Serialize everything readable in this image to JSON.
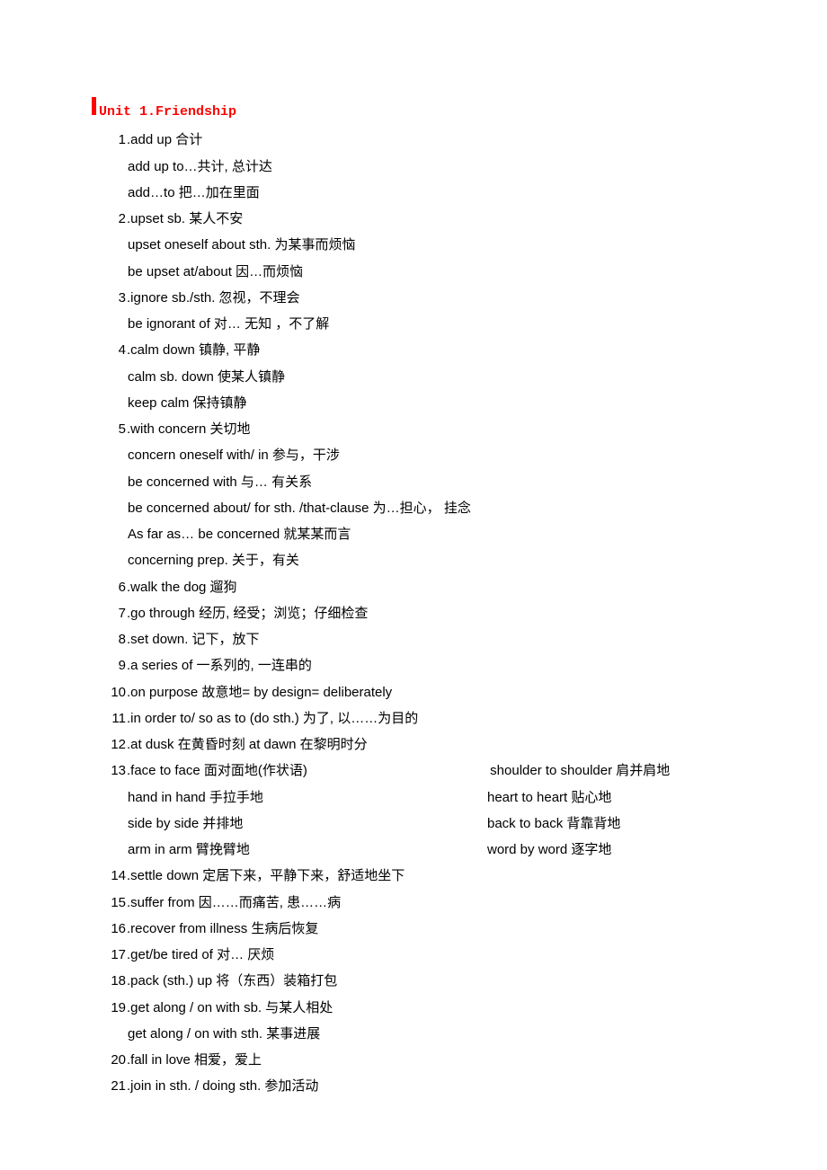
{
  "heading": "Unit 1.Friendship",
  "entries": [
    {
      "num": "1",
      "main": "add up 合计",
      "subs": [
        "add up to…共计, 总计达",
        "add…to 把…加在里面"
      ]
    },
    {
      "num": "2",
      "main": "upset sb.  某人不安",
      "subs": [
        "upset oneself about sth.  为某事而烦恼",
        "be upset at/about  因…而烦恼"
      ]
    },
    {
      "num": "3",
      "main": "ignore sb./sth.  忽视，不理会",
      "subs": [
        "be ignorant of  对…  无知   ，不了解"
      ]
    },
    {
      "num": "4",
      "main": "calm down 镇静, 平静",
      "subs": [
        "calm sb. down  使某人镇静",
        "keep calm  保持镇静"
      ]
    },
    {
      "num": "5",
      "main": "with concern 关切地",
      "subs": [
        "concern oneself with/ in  参与，干涉",
        "be concerned with  与…  有关系",
        "be concerned about/ for sth. /that-clause  为…担心，  挂念",
        "As far as…  be concerned  就某某而言",
        "concerning prep. 关于，有关"
      ]
    },
    {
      "num": "6",
      "main": "walk the dog  遛狗"
    },
    {
      "num": "7",
      "main": "go through  经历,  经受；浏览；仔细检查"
    },
    {
      "num": "8",
      "main": "set down. 记下，放下"
    },
    {
      "num": "9",
      "main": "a series of 一系列的, 一连串的"
    },
    {
      "num": "10",
      "main": "on purpose 故意地= by design= deliberately"
    },
    {
      "num": "11",
      "main": "in order to/ so as to (do sth.)  为了, 以……为目的"
    },
    {
      "num": "12",
      "main": "at dusk 在黄昏时刻    at dawn 在黎明时分"
    },
    {
      "num": "13",
      "cols": [
        {
          "l": "face to face  面对面地(作状语)",
          "r": "shoulder to shoulder 肩并肩地"
        }
      ],
      "subcols": [
        {
          "l": "hand in hand 手拉手地",
          "r": "heart to heart  贴心地"
        },
        {
          "l": "side by side  并排地",
          "r": "back to back  背靠背地"
        },
        {
          "l": "arm in arm  臂挽臂地",
          "r": "word by word  逐字地"
        }
      ]
    },
    {
      "num": "14",
      "main": "settle down 定居下来，平静下来，舒适地坐下"
    },
    {
      "num": "15",
      "main": "suffer from 因……而痛苦, 患……病"
    },
    {
      "num": "16",
      "main": "recover from illness  生病后恢复"
    },
    {
      "num": "17",
      "main": "get/be tired of  对…  厌烦"
    },
    {
      "num": "18",
      "main": "pack (sth.) up  将（东西）装箱打包"
    },
    {
      "num": "19",
      "main": "get along / on with sb.  与某人相处",
      "subs": [
        "get along / on with sth.  某事进展"
      ]
    },
    {
      "num": "20",
      "main": "fall in love  相爱，爱上"
    },
    {
      "num": "21",
      "main": "join in sth. / doing sth.  参加活动"
    }
  ]
}
